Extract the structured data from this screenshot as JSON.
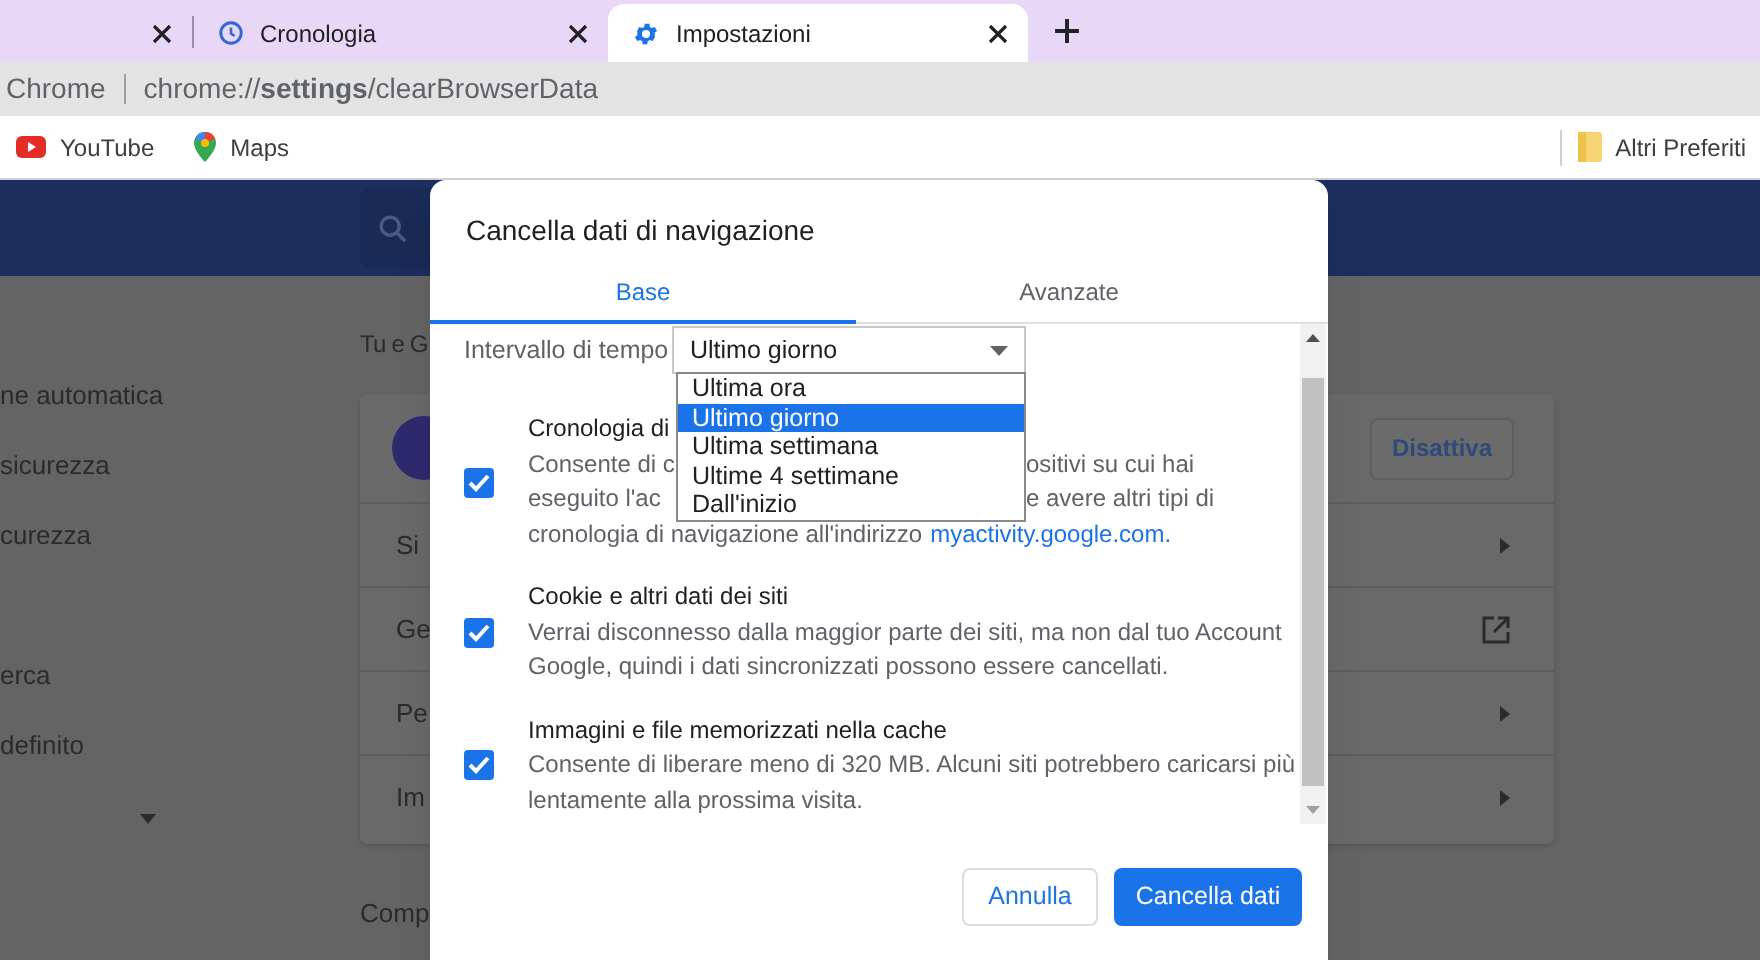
{
  "tabs": [
    {
      "selected": false
    },
    {
      "title": "Cronologia",
      "kind": "history",
      "selected": false
    },
    {
      "title": "Impostazioni",
      "kind": "settings",
      "selected": true
    }
  ],
  "address_bar": {
    "app_label": "Chrome",
    "url": "chrome://**settings**/clearBrowserData"
  },
  "bookmarks": [
    {
      "label": "YouTube",
      "kind": "youtube"
    },
    {
      "label": "Maps",
      "kind": "maps"
    }
  ],
  "other_bookmarks": "Altri Preferiti",
  "settings_page": {
    "nav_groups": [
      [
        "ne automatica",
        "sicurezza",
        "curezza"
      ],
      [
        "erca",
        "definito"
      ]
    ],
    "section_title": "Tu e G",
    "card": {
      "button": "Disattiva",
      "rows": [
        {
          "label": "Si",
          "kind": "chevron"
        },
        {
          "label": "Ge",
          "kind": "external"
        },
        {
          "label": "Pe",
          "kind": "chevron"
        },
        {
          "label": "Im",
          "kind": "chevron"
        }
      ]
    },
    "next_section_title": "Comp"
  },
  "dialog": {
    "title": "Cancella dati di navigazione",
    "tabs": [
      {
        "label": "Base",
        "selected": true
      },
      {
        "label": "Avanzate",
        "selected": false
      }
    ],
    "time_range": {
      "label": "Intervallo di tempo",
      "value": "Ultimo giorno",
      "expanded": true,
      "options": [
        {
          "label": "Ultima ora",
          "selected": false
        },
        {
          "label": "Ultimo giorno",
          "selected": true
        },
        {
          "label": "Ultima settimana",
          "selected": false
        },
        {
          "label": "Ultime 4 settimane",
          "selected": false
        },
        {
          "label": "Dall'inizio",
          "selected": false
        }
      ]
    },
    "items": [
      {
        "checked": true,
        "title": "Cronologia di",
        "lines": [
          {
            "left": "Consente di c",
            "right": "ositivi su cui hai"
          },
          {
            "left": "eseguito l'ac",
            "right": "e avere altri tipi di"
          },
          {
            "text": "cronologia di navigazione all'indirizzo",
            "link": "myactivity.google.com."
          }
        ]
      },
      {
        "checked": true,
        "title": "Cookie e altri dati dei siti",
        "lines": [
          {
            "text": "Verrai disconnesso dalla maggior parte dei siti, ma non dal tuo Account"
          },
          {
            "text": "Google, quindi i dati sincronizzati possono essere cancellati."
          }
        ]
      },
      {
        "checked": true,
        "title": "Immagini e file memorizzati nella cache",
        "lines": [
          {
            "text": "Consente di liberare meno di 320 MB. Alcuni siti potrebbero caricarsi più"
          },
          {
            "text": "lentamente alla prossima visita."
          }
        ]
      }
    ],
    "buttons": [
      {
        "label": "Annulla",
        "kind": "secondary"
      },
      {
        "label": "Cancella dati",
        "kind": "primary"
      }
    ]
  }
}
